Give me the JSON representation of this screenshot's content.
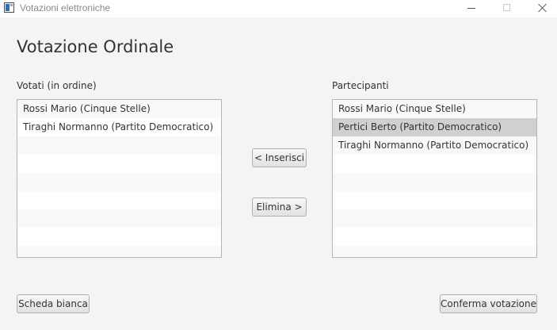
{
  "window": {
    "title": "Votazioni elettroniche",
    "icon": "app-window-icon"
  },
  "page": {
    "title": "Votazione Ordinale"
  },
  "voted": {
    "label": "Votati (in ordine)",
    "items": [
      "Rossi Mario (Cinque Stelle)",
      "Tiraghi Normanno (Partito Democratico)"
    ]
  },
  "participants": {
    "label": "Partecipanti",
    "items": [
      "Rossi Mario (Cinque Stelle)",
      "Pertici Berto (Partito Democratico)",
      "Tiraghi Normanno (Partito Democratico)"
    ],
    "selected_index": 1
  },
  "actions": {
    "insert_label": "< Inserisci",
    "remove_label": "Elimina >",
    "blank_ballot_label": "Scheda bianca",
    "confirm_label": "Conferma votazione"
  },
  "colors": {
    "background": "#f4f4f4",
    "selected_row": "#d0d0d0",
    "alt_row": "#f9f9f9"
  }
}
